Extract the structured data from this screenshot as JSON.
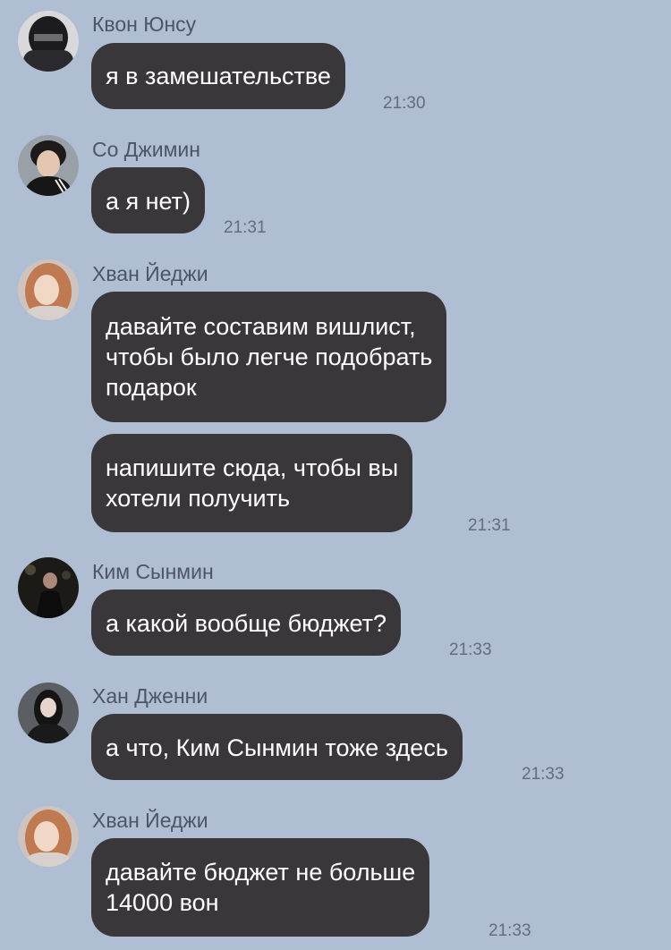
{
  "messages": [
    {
      "sender": "Квон Юнсу",
      "text": "я в замешательстве",
      "time": "21:30"
    },
    {
      "sender": "Со Джимин",
      "text": "а я нет)",
      "time": "21:31"
    },
    {
      "sender": "Хван Йеджи",
      "text": "давайте составим вишлист,\nчтобы было легче подобрать\nподарок"
    },
    {
      "text": "напишите сюда, чтобы вы\nхотели получить",
      "time": "21:31"
    },
    {
      "sender": "Ким Сынмин",
      "text": "а какой вообще бюджет?",
      "time": "21:33"
    },
    {
      "sender": "Хан Дженни",
      "text": "а что, Ким Сынмин тоже здесь",
      "time": "21:33"
    },
    {
      "sender": "Хван Йеджи",
      "text": "давайте бюджет не больше\n14000 вон",
      "time": "21:33"
    }
  ],
  "colors": {
    "background": "#b0bed3",
    "bubble": "#3a373b",
    "bubble_text": "#ffffff",
    "sender_name": "#4b5565",
    "timestamp": "#626d7d"
  }
}
